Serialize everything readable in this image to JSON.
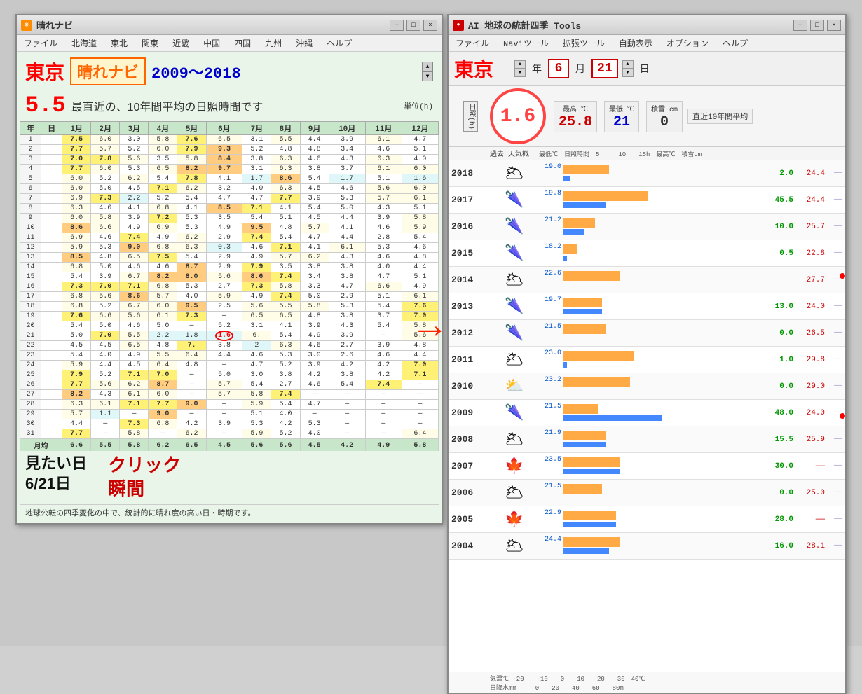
{
  "leftWindow": {
    "title": "晴れナビ",
    "icon": "☀",
    "menus": [
      "ファイル",
      "北海道",
      "東北",
      "関東",
      "近畿",
      "中国",
      "四国",
      "九州",
      "沖縄",
      "ヘルプ"
    ],
    "cityName": "東京",
    "appName": "晴れナビ",
    "yearRange": "2009～2018",
    "sunshineValue": "5.5",
    "sunshineLabel": "最直近の、10年間平均の日照時間です",
    "unitLabel": "単位(h)",
    "columnHeaders": [
      "年",
      "日",
      "1月",
      "2月",
      "3月",
      "4月",
      "5月",
      "6月",
      "7月",
      "8月",
      "9月",
      "10月",
      "11月",
      "12月"
    ],
    "monthAvgLabel": "月均",
    "monthAvgValues": [
      "6.6",
      "5.5",
      "5.8",
      "6.2",
      "6.5",
      "4.5",
      "5.6",
      "5.6",
      "4.5",
      "4.2",
      "4.9",
      "5.8"
    ],
    "footerText": "地球公転の四季変化の中で、統計的に晴れ度の高い日・時期です。",
    "annotationLine1": "見たい日",
    "annotationLine2": "6/21日",
    "annotationClick": "クリック",
    "annotationMoment": "瞬間",
    "rows": [
      {
        "day": "1",
        "vals": [
          "7.5",
          "6.0",
          "3.0",
          "5.8",
          "7.6",
          "6.5",
          "3.1",
          "5.5",
          "4.4",
          "3.9",
          "6.1",
          "4.7"
        ]
      },
      {
        "day": "2",
        "vals": [
          "7.7",
          "5.7",
          "5.2",
          "6.0",
          "7.9",
          "9.3",
          "5.2",
          "4.8",
          "4.8",
          "3.4",
          "4.6",
          "5.1"
        ]
      },
      {
        "day": "3",
        "vals": [
          "7.0",
          "7.8",
          "5.6",
          "3.5",
          "5.8",
          "8.4",
          "3.8",
          "6.3",
          "4.6",
          "4.3",
          "6.3",
          "4.0"
        ]
      },
      {
        "day": "4",
        "vals": [
          "7.7",
          "6.0",
          "5.3",
          "6.5",
          "8.2",
          "9.7",
          "3.1",
          "6.3",
          "3.8",
          "3.7",
          "6.1",
          "6.0"
        ]
      },
      {
        "day": "5",
        "vals": [
          "6.0",
          "5.2",
          "6.2",
          "5.4",
          "7.8",
          "4.1",
          "1.7",
          "8.6",
          "5.4",
          "1.7",
          "5.1",
          "1.6"
        ]
      },
      {
        "day": "6",
        "vals": [
          "6.0",
          "5.0",
          "4.5",
          "7.1",
          "6.2",
          "3.2",
          "4.0",
          "6.3",
          "4.5",
          "4.6",
          "5.6",
          "6.0"
        ]
      },
      {
        "day": "7",
        "vals": [
          "6.9",
          "7.3",
          "2.2",
          "5.2",
          "5.4",
          "4.7",
          "4.7",
          "7.7",
          "3.9",
          "5.3",
          "5.7",
          "6.1"
        ]
      },
      {
        "day": "8",
        "vals": [
          "6.3",
          "4.6",
          "4.1",
          "6.8",
          "4.1",
          "8.5",
          "7.1",
          "4.1",
          "5.4",
          "5.0",
          "4.3",
          "5.1"
        ]
      },
      {
        "day": "9",
        "vals": [
          "6.0",
          "5.8",
          "3.9",
          "7.2",
          "5.3",
          "3.5",
          "5.4",
          "5.1",
          "4.5",
          "4.4",
          "3.9",
          "5.8"
        ]
      },
      {
        "day": "10",
        "vals": [
          "8.6",
          "6.6",
          "4.9",
          "6.9",
          "5.3",
          "4.9",
          "9.5",
          "4.8",
          "5.7",
          "4.1",
          "4.6",
          "5.9"
        ]
      },
      {
        "day": "11",
        "vals": [
          "6.9",
          "4.6",
          "7.4",
          "4.9",
          "6.2",
          "2.9",
          "7.4",
          "5.4",
          "4.7",
          "4.4",
          "2.8",
          "5.4"
        ]
      },
      {
        "day": "12",
        "vals": [
          "5.9",
          "5.3",
          "9.0",
          "6.8",
          "6.3",
          "0.3",
          "4.6",
          "7.1",
          "4.1",
          "6.1",
          "5.3",
          "4.6"
        ]
      },
      {
        "day": "13",
        "vals": [
          "8.5",
          "4.8",
          "6.5",
          "7.5",
          "5.4",
          "2.9",
          "4.9",
          "5.7",
          "6.2",
          "4.3",
          "4.6",
          "4.8"
        ]
      },
      {
        "day": "14",
        "vals": [
          "6.8",
          "5.0",
          "4.6",
          "4.6",
          "8.7",
          "2.9",
          "7.9",
          "3.5",
          "3.8",
          "3.8",
          "4.0",
          "4.4"
        ]
      },
      {
        "day": "15",
        "vals": [
          "5.4",
          "3.9",
          "6.7",
          "8.2",
          "8.0",
          "5.6",
          "8.6",
          "7.4",
          "3.4",
          "3.8",
          "4.7",
          "5.1"
        ]
      },
      {
        "day": "16",
        "vals": [
          "7.3",
          "7.0",
          "7.1",
          "6.8",
          "5.3",
          "2.7",
          "7.3",
          "5.8",
          "3.3",
          "4.7",
          "6.6",
          "4.9"
        ]
      },
      {
        "day": "17",
        "vals": [
          "6.8",
          "5.6",
          "8.6",
          "5.7",
          "4.0",
          "5.9",
          "4.9",
          "7.4",
          "5.0",
          "2.9",
          "5.1",
          "6.1"
        ]
      },
      {
        "day": "18",
        "vals": [
          "6.8",
          "5.2",
          "6.7",
          "6.0",
          "9.5",
          "2.5",
          "5.6",
          "5.5",
          "5.8",
          "5.3",
          "5.4",
          "7.6"
        ]
      },
      {
        "day": "19",
        "vals": [
          "7.6",
          "6.6",
          "5.6",
          "6.1",
          "7.3",
          "—",
          "6.5",
          "6.5",
          "4.8",
          "3.8",
          "3.7",
          "7.0"
        ]
      },
      {
        "day": "20",
        "vals": [
          "5.4",
          "5.0",
          "4.6",
          "5.0",
          "—",
          "5.2",
          "3.1",
          "4.1",
          "3.9",
          "4.3",
          "5.4",
          "5.8"
        ]
      },
      {
        "day": "21",
        "vals": [
          "5.0",
          "7.0",
          "5.5",
          "2.2",
          "1.8",
          "1.6",
          "6.",
          "5.4",
          "4.9",
          "3.9",
          "—",
          "5.6"
        ]
      },
      {
        "day": "22",
        "vals": [
          "4.5",
          "4.5",
          "6.5",
          "4.8",
          "7.",
          "3.8",
          "2",
          "6.3",
          "4.6",
          "2.7",
          "3.9",
          "4.8"
        ]
      },
      {
        "day": "23",
        "vals": [
          "5.4",
          "4.0",
          "4.9",
          "5.5",
          "6.4",
          "4.4",
          "4.6",
          "5.3",
          "3.0",
          "2.6",
          "4.6",
          "4.4"
        ]
      },
      {
        "day": "24",
        "vals": [
          "5.9",
          "4.4",
          "4.5",
          "6.4",
          "4.8",
          "—",
          "4.7",
          "5.2",
          "3.9",
          "4.2",
          "4.2",
          "7.0"
        ]
      },
      {
        "day": "25",
        "vals": [
          "7.9",
          "5.2",
          "7.1",
          "7.0",
          "—",
          "5.0",
          "3.0",
          "3.8",
          "4.2",
          "3.8",
          "4.2",
          "7.1"
        ]
      },
      {
        "day": "26",
        "vals": [
          "7.7",
          "5.6",
          "6.2",
          "8.7",
          "—",
          "5.7",
          "5.4",
          "2.7",
          "4.6",
          "5.4",
          "7.4",
          "—"
        ]
      },
      {
        "day": "27",
        "vals": [
          "8.2",
          "4.3",
          "6.1",
          "6.0",
          "—",
          "5.7",
          "5.8",
          "7.4",
          "—",
          "—",
          "—",
          "—"
        ]
      },
      {
        "day": "28",
        "vals": [
          "6.3",
          "6.1",
          "7.1",
          "7.7",
          "9.0",
          "—",
          "5.9",
          "5.4",
          "4.7",
          "—",
          "—",
          "—"
        ]
      },
      {
        "day": "29",
        "vals": [
          "5.7",
          "1.1",
          "—",
          "9.0",
          "—",
          "—",
          "5.1",
          "4.0",
          "—",
          "—",
          "—",
          "—"
        ]
      },
      {
        "day": "30",
        "vals": [
          "4.4",
          "—",
          "7.3",
          "6.8",
          "4.2",
          "3.9",
          "5.3",
          "4.2",
          "5.3",
          "—",
          "—",
          "—"
        ]
      },
      {
        "day": "31",
        "vals": [
          "7.7",
          "—",
          "5.8",
          "—",
          "6.2",
          "—",
          "5.9",
          "5.2",
          "4.0",
          "—",
          "—",
          "6.4"
        ]
      }
    ]
  },
  "rightWindow": {
    "title": "AI 地球の統計四季 Tools",
    "icon": "🔴",
    "menus": [
      "ファイル",
      "Naviツール",
      "拡張ツール",
      "自動表示",
      "オプション",
      "ヘルプ"
    ],
    "cityName": "東京",
    "yearLabel": "年",
    "yearValue": "6",
    "monthLabel": "月",
    "dayLabel": "日",
    "dayValue": "21",
    "sunshineValue": "1.6",
    "sunshineLabelH": "日照(h)",
    "maxTempLabel": "最高 ℃",
    "maxTempValue": "25.8",
    "minTempLabel": "最低 ℃",
    "minTempValue": "21",
    "snowLabel": "積雪 cm",
    "snowValue": "0",
    "recentAvgLabel": "直近10年間平均",
    "chartHeaderCols": [
      "過去 天気概",
      "最低℃",
      "日照時間",
      "5",
      "10",
      "15h",
      "最高℃",
      "積雪cm"
    ],
    "chartRows": [
      {
        "year": "2018",
        "icon": "🌥",
        "minTemp": "19.0",
        "sunshine": "2.0",
        "maxTemp": "24.4",
        "barOrangeW": 65,
        "barBlueW": 10
      },
      {
        "year": "2017",
        "icon": "🌂",
        "minTemp": "19.8",
        "sunshine": "45.5",
        "maxTemp": "24.4",
        "barOrangeW": 120,
        "barBlueW": 60
      },
      {
        "year": "2016",
        "icon": "🌂",
        "minTemp": "21.2",
        "sunshine": "10.0",
        "maxTemp": "25.7",
        "barOrangeW": 45,
        "barBlueW": 30,
        "hasDot": true
      },
      {
        "year": "2015",
        "icon": "🌂",
        "minTemp": "18.2",
        "sunshine": "0.5",
        "maxTemp": "22.8",
        "barOrangeW": 20,
        "barBlueW": 5
      },
      {
        "year": "2014",
        "icon": "🌥",
        "minTemp": "22.6",
        "sunshine": "",
        "maxTemp": "27.7",
        "barOrangeW": 80,
        "barBlueW": 0
      },
      {
        "year": "2013",
        "icon": "🌂",
        "minTemp": "19.7",
        "sunshine": "13.0",
        "maxTemp": "24.0",
        "barOrangeW": 55,
        "barBlueW": 55
      },
      {
        "year": "2012",
        "icon": "🌂",
        "minTemp": "21.5",
        "sunshine": "0.0",
        "maxTemp": "26.5",
        "barOrangeW": 60,
        "barBlueW": 0
      },
      {
        "year": "2011",
        "icon": "🌥",
        "minTemp": "23.0",
        "sunshine": "1.0",
        "maxTemp": "29.8",
        "barOrangeW": 100,
        "barBlueW": 5
      },
      {
        "year": "2010",
        "icon": "⛅",
        "minTemp": "23.2",
        "sunshine": "0.0",
        "maxTemp": "29.0",
        "barOrangeW": 95,
        "barBlueW": 0
      },
      {
        "year": "2009",
        "icon": "🌂",
        "minTemp": "21.5",
        "sunshine": "48.0",
        "maxTemp": "24.0",
        "barOrangeW": 50,
        "barBlueW": 140
      },
      {
        "year": "2008",
        "icon": "🌥",
        "minTemp": "21.9",
        "sunshine": "15.5",
        "maxTemp": "25.9",
        "barOrangeW": 60,
        "barBlueW": 60,
        "hasDot": true
      },
      {
        "year": "2007",
        "icon": "🍁",
        "minTemp": "23.5",
        "sunshine": "30.0",
        "maxTemp": "",
        "barOrangeW": 80,
        "barBlueW": 80
      },
      {
        "year": "2006",
        "icon": "🌥",
        "minTemp": "21.5",
        "sunshine": "0.0",
        "maxTemp": "25.0",
        "barOrangeW": 55,
        "barBlueW": 0
      },
      {
        "year": "2005",
        "icon": "🍁",
        "minTemp": "22.9",
        "sunshine": "28.0",
        "maxTemp": "",
        "barOrangeW": 75,
        "barBlueW": 75
      },
      {
        "year": "2004",
        "icon": "🌥",
        "minTemp": "24.4",
        "sunshine": "16.0",
        "maxTemp": "28.1",
        "barOrangeW": 80,
        "barBlueW": 65
      }
    ],
    "axisLabels": {
      "tempAxis": "気温℃ -20  -10   0   10   20   30   40℃",
      "rainAxis": "日降水mm       0   20   40   60   80m"
    }
  },
  "arrowText": "→",
  "titlebarControls": {
    "minimize": "─",
    "maximize": "□",
    "close": "×"
  }
}
